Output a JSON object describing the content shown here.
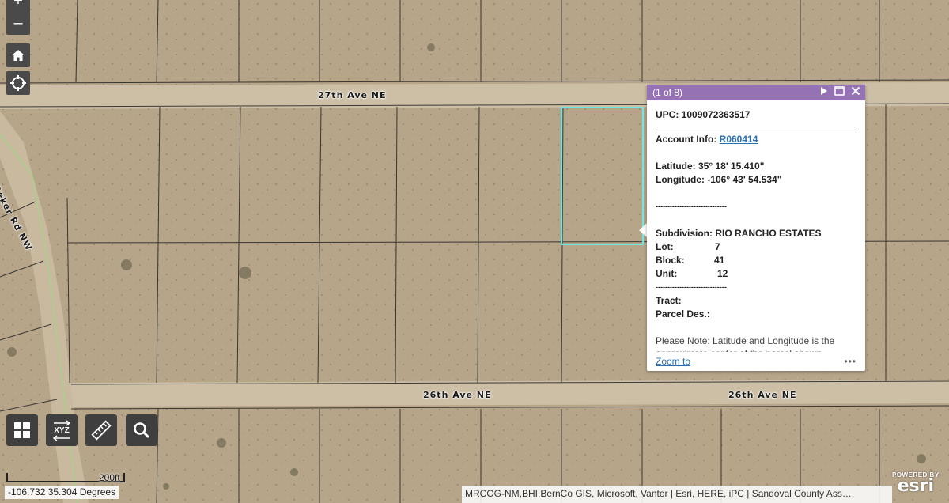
{
  "map": {
    "roads": [
      {
        "label": "27th Ave NE"
      },
      {
        "label": "26th Ave NE"
      },
      {
        "label": "26th Ave NE"
      },
      {
        "label": "Beker Rd NW"
      }
    ],
    "colors": {
      "ground": "#b7a58a",
      "selection": "#6fe8e3",
      "popup_header": "#9472b3"
    }
  },
  "controls": {
    "zoom_in": "+",
    "zoom_out": "–",
    "home_icon": "home-icon",
    "locate_icon": "locate-icon"
  },
  "popup": {
    "pager": "(1 of 8)",
    "upc": "UPC: 1009072363517",
    "account_label": "Account Info: ",
    "account_link": "R060414",
    "latitude": "Latitude: 35° 18' 15.410\"",
    "longitude": "Longitude: -106° 43' 54.534\"",
    "divider1": "------------------------------",
    "subdivision": "Subdivision: RIO RANCHO ESTATES",
    "lot_label": "Lot:",
    "lot_value": "7",
    "block_label": "Block:",
    "block_value": "41",
    "unit_label": "Unit:",
    "unit_value": "12",
    "divider2": "------------------------------",
    "tract": "Tract:",
    "parcel_des": "Parcel Des.:",
    "note": "Please Note: Latitude and Longitude is the approximate center of the parcel shown.",
    "zoom_to": "Zoom to",
    "more": "•••"
  },
  "toolbar": {
    "xyz_label": "XYZ"
  },
  "footer": {
    "coordinates": "-106.732 35.304 Degrees",
    "scale": "200ft",
    "attribution": "MRCOG-NM,BHI,BernCo GIS, Microsoft, Vantor | Esri, HERE, iPC | Sandoval County Ass…",
    "powered_by": "POWERED BY",
    "esri": "esri"
  }
}
